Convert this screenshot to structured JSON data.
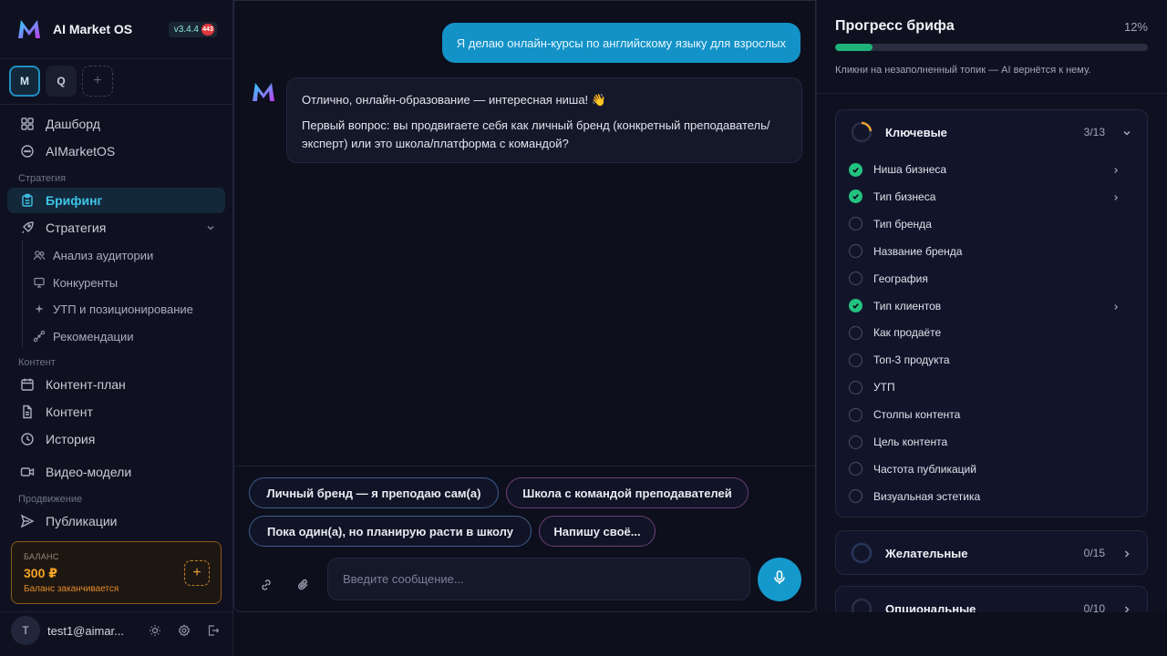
{
  "sidebar": {
    "app_name": "AI Market OS",
    "version": "v3.4.4",
    "version_badge": "443",
    "workspaces": [
      {
        "label": "M"
      },
      {
        "label": "Q"
      },
      {
        "label": "+"
      }
    ],
    "nav": {
      "dashboard": "Дашборд",
      "aimarketos": "AIMarketOS",
      "section_strategy": "Стратегия",
      "briefing": "Брифинг",
      "strategy": "Стратегия",
      "audience": "Анализ аудитории",
      "competitors": "Конкуренты",
      "usp": "УТП и позиционирование",
      "recommendations": "Рекомендации",
      "section_content": "Контент",
      "content_plan": "Контент-план",
      "content": "Контент",
      "history": "История",
      "video_models": "Видео-модели",
      "section_promotion": "Продвижение",
      "publications": "Публикации"
    },
    "balance": {
      "label": "БАЛАНС",
      "amount": "300 ₽",
      "warning": "Баланс заканчивается",
      "add": "+"
    },
    "user": {
      "avatar": "T",
      "email": "test1@aimar..."
    }
  },
  "chat": {
    "user_message": "Я делаю онлайн-курсы по английскому языку для взрослых",
    "bot_line1": "Отлично, онлайн-образование — интересная ниша! 👋",
    "bot_line2": "Первый вопрос: вы продвигаете себя как личный бренд (конкретный преподаватель/эксперт) или это школа/платформа с командой?",
    "quick_replies": [
      "Личный бренд — я преподаю сам(а)",
      "Школа с командой преподавателей",
      "Пока один(а), но планирую расти в школу",
      "Напишу своё..."
    ],
    "input_placeholder": "Введите сообщение..."
  },
  "progress": {
    "title": "Прогресс брифа",
    "percent_label": "12%",
    "percent_value": 0.12,
    "hint": "Кликни на незаполненный топик — AI вернётся к нему.",
    "groups": [
      {
        "name": "Ключевые",
        "count": "3/13",
        "expanded": true,
        "topics": [
          {
            "label": "Ниша бизнеса",
            "done": true
          },
          {
            "label": "Тип бизнеса",
            "done": true
          },
          {
            "label": "Тип бренда",
            "done": false
          },
          {
            "label": "Название бренда",
            "done": false
          },
          {
            "label": "География",
            "done": false
          },
          {
            "label": "Тип клиентов",
            "done": true
          },
          {
            "label": "Как продаёте",
            "done": false
          },
          {
            "label": "Топ-3 продукта",
            "done": false
          },
          {
            "label": "УТП",
            "done": false
          },
          {
            "label": "Столпы контента",
            "done": false
          },
          {
            "label": "Цель контента",
            "done": false
          },
          {
            "label": "Частота публикаций",
            "done": false
          },
          {
            "label": "Визуальная эстетика",
            "done": false
          }
        ]
      },
      {
        "name": "Желательные",
        "count": "0/15",
        "expanded": false
      },
      {
        "name": "Опциональные",
        "count": "0/10",
        "expanded": false
      }
    ]
  },
  "colors": {
    "accent": "#1599cc",
    "success": "#22c37f",
    "warning": "#f5a424"
  }
}
